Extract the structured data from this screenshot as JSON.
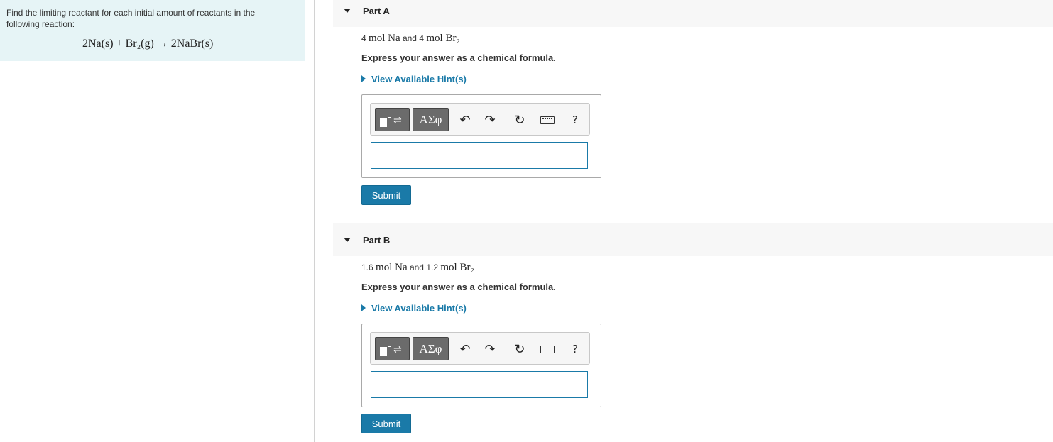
{
  "question": {
    "intro": "Find the limiting reactant for each initial amount of reactants in the following reaction:",
    "reaction": "2Na(s) + Br₂(g) → 2NaBr(s)"
  },
  "toolbar": {
    "greek_label": "ΑΣφ",
    "undo_glyph": "↶",
    "redo_glyph": "↷",
    "reset_glyph": "↻",
    "help_glyph": "?"
  },
  "parts": [
    {
      "title": "Part A",
      "amount_a_num": "4",
      "amount_a_unit": "mol Na",
      "amount_join": "and",
      "amount_b_num": "4",
      "amount_b_unit": "mol Br₂",
      "instruction": "Express your answer as a chemical formula.",
      "hint_label": "View Available Hint(s)",
      "answer_value": "",
      "submit_label": "Submit"
    },
    {
      "title": "Part B",
      "amount_a_num": "1.6",
      "amount_a_unit": "mol Na",
      "amount_join": "and",
      "amount_b_num": "1.2",
      "amount_b_unit": "mol Br₂",
      "instruction": "Express your answer as a chemical formula.",
      "hint_label": "View Available Hint(s)",
      "answer_value": "",
      "submit_label": "Submit"
    }
  ]
}
